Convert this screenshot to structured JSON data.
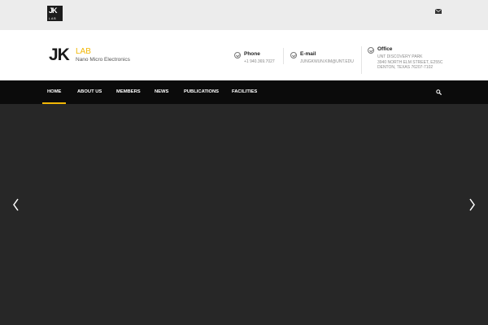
{
  "topbar": {
    "logo": {
      "jk": "JK",
      "lab": "LAB"
    },
    "mail_icon": "envelope-icon"
  },
  "header": {
    "brand": {
      "jk": "JK",
      "lab": "LAB",
      "subtitle": "Nano Micro Electronics"
    },
    "contacts": [
      {
        "title": "Phone",
        "lines": [
          "+1 940.369.7027"
        ]
      },
      {
        "title": "E-mail",
        "lines": [
          "JUNGKWUN.KIM@UNT.EDU"
        ]
      },
      {
        "title": "Office",
        "lines": [
          "UNT DISCOVERY PARK",
          "3940 NORTH ELM STREET, E255C",
          "DENTON, TEXAS 76207-7102"
        ]
      }
    ]
  },
  "nav": {
    "items": [
      "HOME",
      "ABOUT US",
      "MEMBERS",
      "NEWS",
      "PUBLICATIONS",
      "FACILITIES"
    ],
    "active_index": 0,
    "search_icon": "search-icon"
  },
  "slider": {
    "prev_icon": "chevron-left-icon",
    "next_icon": "chevron-right-icon"
  },
  "colors": {
    "accent": "#f2b705",
    "nav_bg": "#0b0b0b",
    "hero_bg": "#272727",
    "topbar_bg": "#ececec"
  }
}
